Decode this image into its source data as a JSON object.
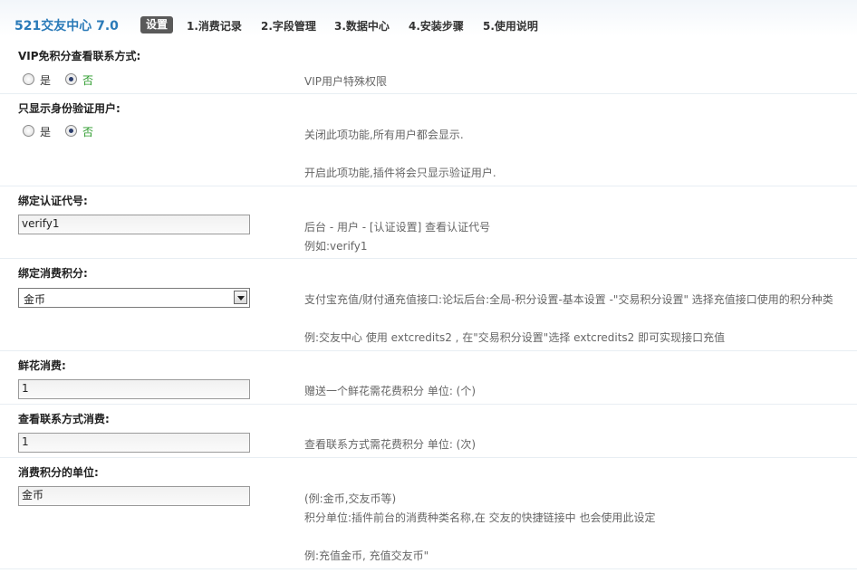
{
  "header": {
    "title": "521交友中心 7.0",
    "tabs": [
      {
        "label": "设置",
        "active": true
      },
      {
        "label": "1.消费记录"
      },
      {
        "label": "2.字段管理"
      },
      {
        "label": "3.数据中心"
      },
      {
        "label": "4.安装步骤"
      },
      {
        "label": "5.使用说明"
      }
    ]
  },
  "settings": {
    "vip_free": {
      "label": "VIP免积分查看联系方式:",
      "options": [
        "是",
        "否"
      ],
      "selected": "否",
      "hint": "VIP用户特殊权限"
    },
    "verified_only": {
      "label": "只显示身份验证用户:",
      "options": [
        "是",
        "否"
      ],
      "selected": "否",
      "hints": [
        "关闭此项功能,所有用户都会显示.",
        "开启此项功能,插件将会只显示验证用户."
      ]
    },
    "verify_code": {
      "label": "绑定认证代号:",
      "value": "verify1",
      "hints": [
        "后台 - 用户 - [认证设置] 查看认证代号",
        "例如:verify1"
      ]
    },
    "credit_type": {
      "label": "绑定消费积分:",
      "selected": "金币",
      "hints": [
        "支付宝充值/财付通充值接口:论坛后台:全局-积分设置-基本设置 -\"交易积分设置\" 选择充值接口使用的积分种类",
        "例:交友中心 使用 extcredits2 , 在\"交易积分设置\"选择 extcredits2 即可实现接口充值"
      ]
    },
    "flower_cost": {
      "label": "鲜花消费:",
      "value": "1",
      "hint": "赠送一个鲜花需花费积分 单位: (个)"
    },
    "contact_cost": {
      "label": "查看联系方式消费:",
      "value": "1",
      "hint": "查看联系方式需花费积分 单位: (次)"
    },
    "credit_unit": {
      "label": "消费积分的单位:",
      "value": "金币",
      "hints": [
        "(例:金币,交友币等)",
        "积分单位:插件前台的消费种类名称,在 交友的快捷链接中 也会使用此设定",
        "例:充值金币, 充值交友币\""
      ]
    }
  }
}
